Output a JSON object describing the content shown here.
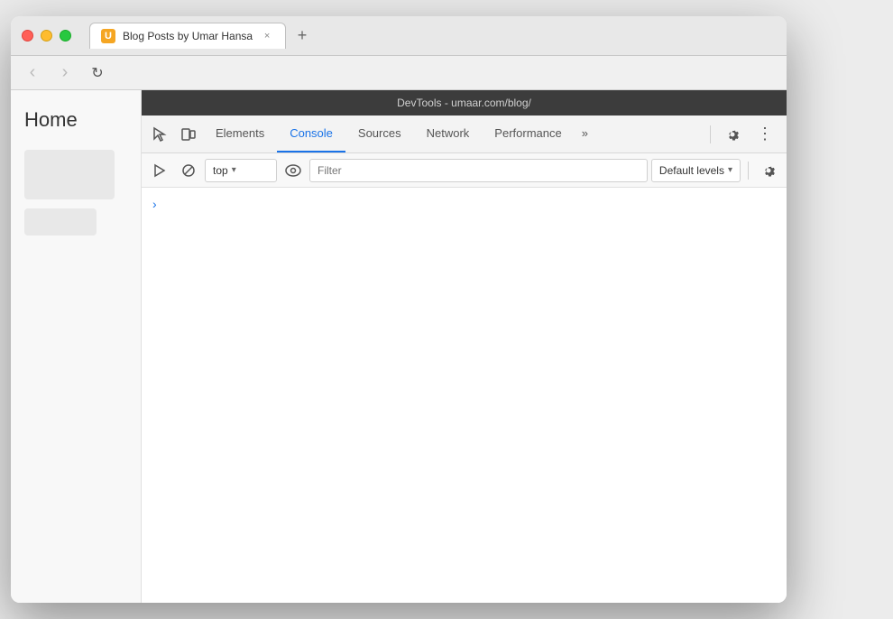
{
  "desktop": {
    "background": "#ececec"
  },
  "browser": {
    "title_bar": {
      "tab_title": "Blog Posts by Umar Hansa",
      "tab_favicon_letter": "U",
      "close_btn": "×",
      "new_tab_btn": "+"
    },
    "nav_bar": {
      "back_btn": "‹",
      "forward_btn": "›",
      "reload_btn": "↻"
    },
    "webpage": {
      "home_label": "Home"
    }
  },
  "devtools": {
    "titlebar": "DevTools - umaar.com/blog/",
    "tabs": [
      {
        "label": "Elements",
        "active": false
      },
      {
        "label": "Console",
        "active": true
      },
      {
        "label": "Sources",
        "active": false
      },
      {
        "label": "Network",
        "active": false
      },
      {
        "label": "Performance",
        "active": false
      }
    ],
    "more_tabs_btn": "»",
    "toolbar": {
      "context_value": "top",
      "context_arrow": "▾",
      "eye_icon": "👁",
      "filter_placeholder": "Filter",
      "levels_label": "Default levels",
      "levels_arrow": "▾"
    },
    "console": {
      "chevron": "›"
    },
    "settings_icon": "⚙",
    "more_icon": "⋮"
  }
}
